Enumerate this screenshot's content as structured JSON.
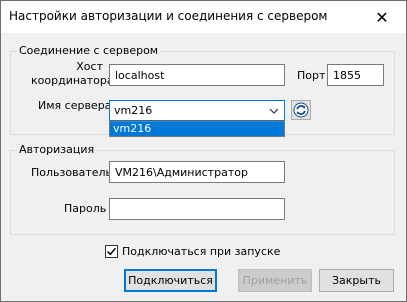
{
  "window": {
    "title": "Настройки авторизации и соединения с сервером",
    "close_glyph": "✕"
  },
  "connection": {
    "legend": "Соединение с сервером",
    "host_label": "Хост\nкоординатора",
    "host_value": "localhost",
    "port_label": "Порт",
    "port_value": "1855",
    "server_label": "Имя сервера",
    "server_value": "vm216",
    "server_options": [
      "vm216"
    ]
  },
  "auth": {
    "legend": "Авторизация",
    "user_label": "Пользователь",
    "user_value": "VM216\\Администратор",
    "password_label": "Пароль",
    "password_value": ""
  },
  "options": {
    "autoconnect_label": "Подключаться при запуске",
    "autoconnect_checked": true
  },
  "buttons": {
    "connect": "Подключиться",
    "apply": "Применить",
    "close": "Закрыть"
  },
  "colors": {
    "accent": "#0078d7",
    "refresh_icon": "#1a4f8b"
  }
}
